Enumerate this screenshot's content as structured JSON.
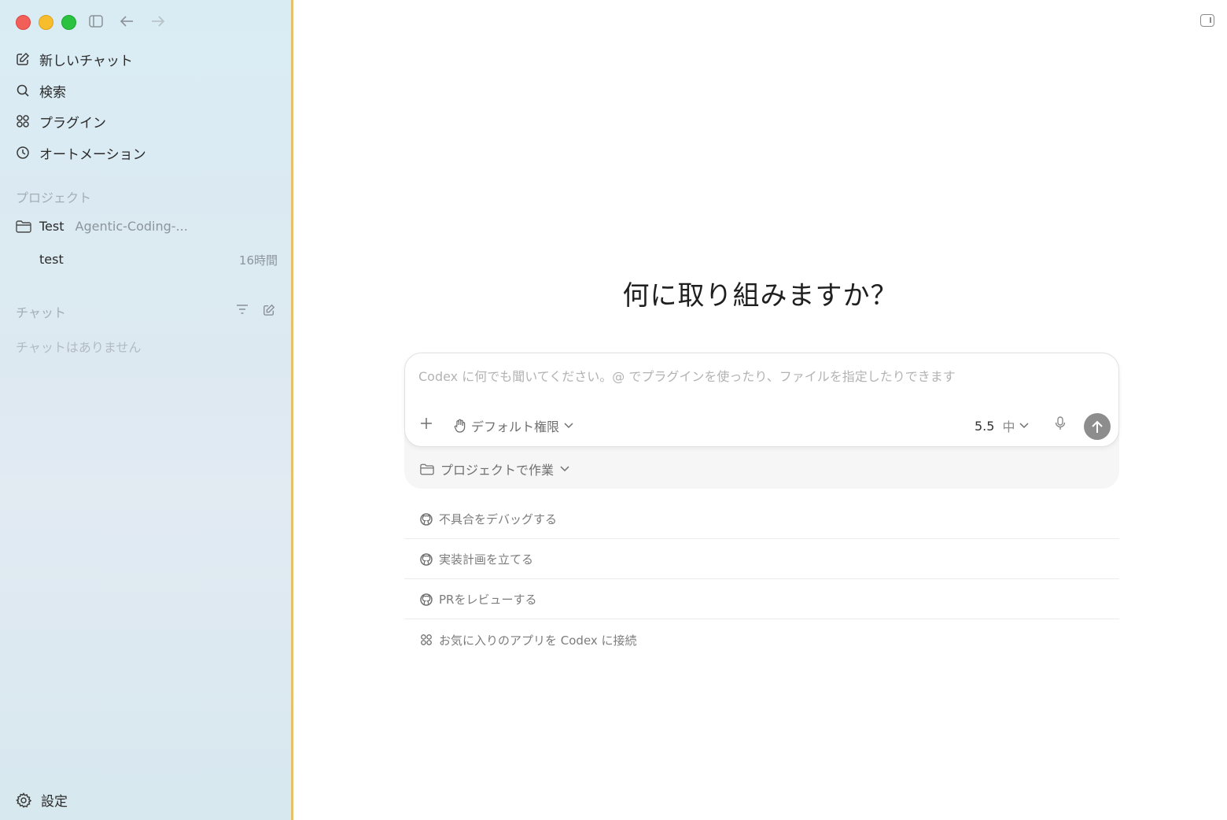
{
  "sidebar": {
    "nav": [
      {
        "label": "新しいチャット",
        "icon": "edit-icon"
      },
      {
        "label": "検索",
        "icon": "search-icon"
      },
      {
        "label": "プラグイン",
        "icon": "grid-icon"
      },
      {
        "label": "オートメーション",
        "icon": "clock-icon"
      }
    ],
    "projects_label": "プロジェクト",
    "project": {
      "name": "Test",
      "subtitle": "Agentic-Coding-..."
    },
    "thread": {
      "title": "test",
      "time": "16時間"
    },
    "chats_label": "チャット",
    "chats_empty": "チャットはありません",
    "settings_label": "設定"
  },
  "main": {
    "heading": "何に取り組みますか？",
    "composer": {
      "placeholder": "Codex に何でも聞いてください。@ でプラグインを使ったり、ファイルを指定したりできます",
      "permissions_label": "デフォルト権限",
      "model_version": "5.5",
      "effort_label": "中",
      "project_button_label": "プロジェクトで作業"
    },
    "suggestions": [
      {
        "label": "不具合をデバッグする",
        "icon": "github-icon"
      },
      {
        "label": "実装計画を立てる",
        "icon": "github-icon"
      },
      {
        "label": "PRをレビューする",
        "icon": "github-icon"
      },
      {
        "label": "お気に入りのアプリを Codex に接続",
        "icon": "grid-icon"
      }
    ]
  },
  "colors": {
    "accent_border": "#e6c06a",
    "send_button": "#8d8d8d"
  }
}
